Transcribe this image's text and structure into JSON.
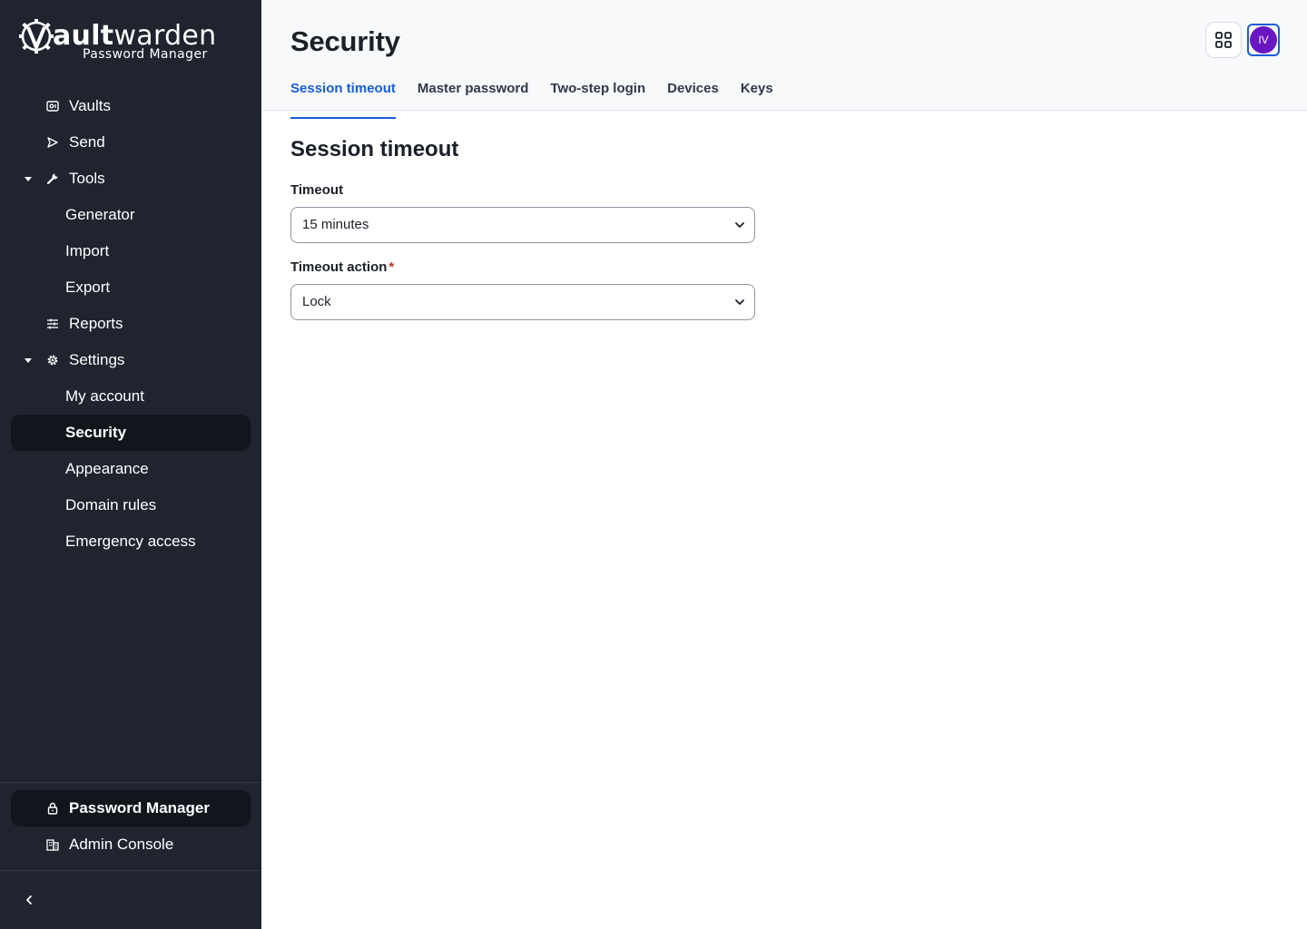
{
  "brand": {
    "name_bold": "ault",
    "name_thin": "warden",
    "subtitle": "Password Manager",
    "mark_letter": "V"
  },
  "sidebar": {
    "items": [
      {
        "label": "Vaults",
        "icon": "vault-icon"
      },
      {
        "label": "Send",
        "icon": "send-icon"
      },
      {
        "label": "Tools",
        "icon": "wrench-icon",
        "expanded": true
      },
      {
        "label": "Generator"
      },
      {
        "label": "Import"
      },
      {
        "label": "Export"
      },
      {
        "label": "Reports",
        "icon": "reports-icon"
      },
      {
        "label": "Settings",
        "icon": "gear-icon",
        "expanded": true
      },
      {
        "label": "My account"
      },
      {
        "label": "Security",
        "active": true
      },
      {
        "label": "Appearance"
      },
      {
        "label": "Domain rules"
      },
      {
        "label": "Emergency access"
      }
    ],
    "footer": [
      {
        "label": "Password Manager",
        "icon": "lock-icon",
        "active": true
      },
      {
        "label": "Admin Console",
        "icon": "building-icon"
      }
    ]
  },
  "header": {
    "title": "Security",
    "tabs": [
      {
        "label": "Session timeout",
        "active": true
      },
      {
        "label": "Master password"
      },
      {
        "label": "Two-step login"
      },
      {
        "label": "Devices"
      },
      {
        "label": "Keys"
      }
    ],
    "avatar_initials": "IV"
  },
  "main": {
    "section_title": "Session timeout",
    "timeout": {
      "label": "Timeout",
      "value": "15 minutes"
    },
    "timeout_action": {
      "label": "Timeout action",
      "required_mark": "*",
      "value": "Lock"
    }
  },
  "colors": {
    "sidebar_bg": "#1f242e",
    "accent": "#175ddc",
    "avatar": "#6a17c3",
    "required": "#c83522"
  }
}
